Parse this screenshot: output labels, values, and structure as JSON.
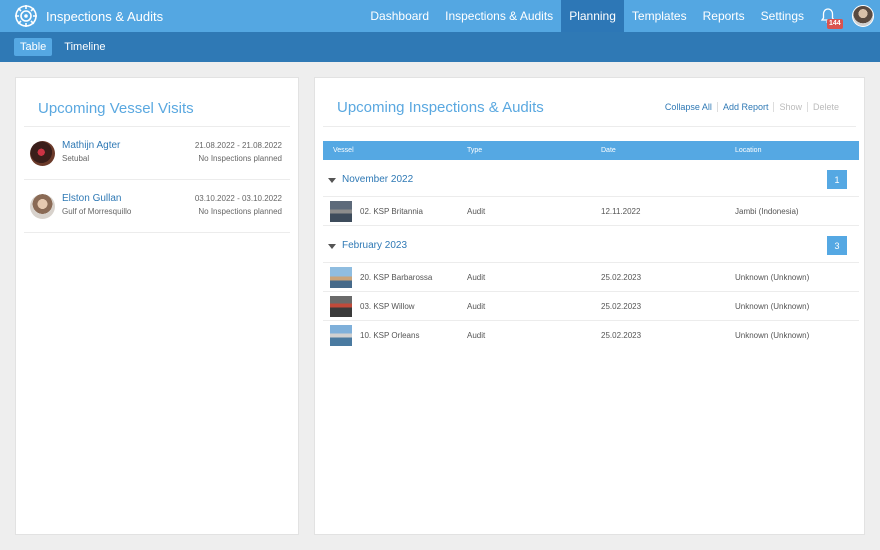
{
  "app": {
    "title": "Inspections & Audits"
  },
  "nav": {
    "items": [
      {
        "label": "Dashboard",
        "active": false
      },
      {
        "label": "Inspections & Audits",
        "active": false
      },
      {
        "label": "Planning",
        "active": true
      },
      {
        "label": "Templates",
        "active": false
      },
      {
        "label": "Reports",
        "active": false
      },
      {
        "label": "Settings",
        "active": false
      }
    ],
    "notification_count": "144"
  },
  "subnav": {
    "tabs": [
      {
        "label": "Table",
        "active": true
      },
      {
        "label": "Timeline",
        "active": false
      }
    ]
  },
  "visits": {
    "title": "Upcoming Vessel Visits",
    "items": [
      {
        "name": "Mathijn Agter",
        "port": "Setubal",
        "dates": "21.08.2022 - 21.08.2022",
        "note": "No Inspections planned"
      },
      {
        "name": "Elston Gullan",
        "port": "Gulf of Morresquillo",
        "dates": "03.10.2022 - 03.10.2022",
        "note": "No Inspections planned"
      }
    ]
  },
  "inspections": {
    "title": "Upcoming Inspections & Audits",
    "actions": {
      "collapse_all": "Collapse All",
      "add_report": "Add Report",
      "show": "Show",
      "delete": "Delete"
    },
    "columns": {
      "vessel": "Vessel",
      "type": "Type",
      "date": "Date",
      "location": "Location"
    },
    "groups": [
      {
        "label": "November 2022",
        "count": "1",
        "rows": [
          {
            "vessel": "02. KSP Britannia",
            "type": "Audit",
            "date": "12.11.2022",
            "location": "Jambi (Indonesia)"
          }
        ]
      },
      {
        "label": "February 2023",
        "count": "3",
        "rows": [
          {
            "vessel": "20. KSP Barbarossa",
            "type": "Audit",
            "date": "25.02.2023",
            "location": "Unknown (Unknown)"
          },
          {
            "vessel": "03. KSP Willow",
            "type": "Audit",
            "date": "25.02.2023",
            "location": "Unknown (Unknown)"
          },
          {
            "vessel": "10. KSP Orleans",
            "type": "Audit",
            "date": "25.02.2023",
            "location": "Unknown (Unknown)"
          }
        ]
      }
    ]
  },
  "icons": {
    "logo": "compass-logo-icon",
    "notifications": "bell-icon",
    "user": "user-avatar",
    "expand": "caret-down-icon"
  }
}
